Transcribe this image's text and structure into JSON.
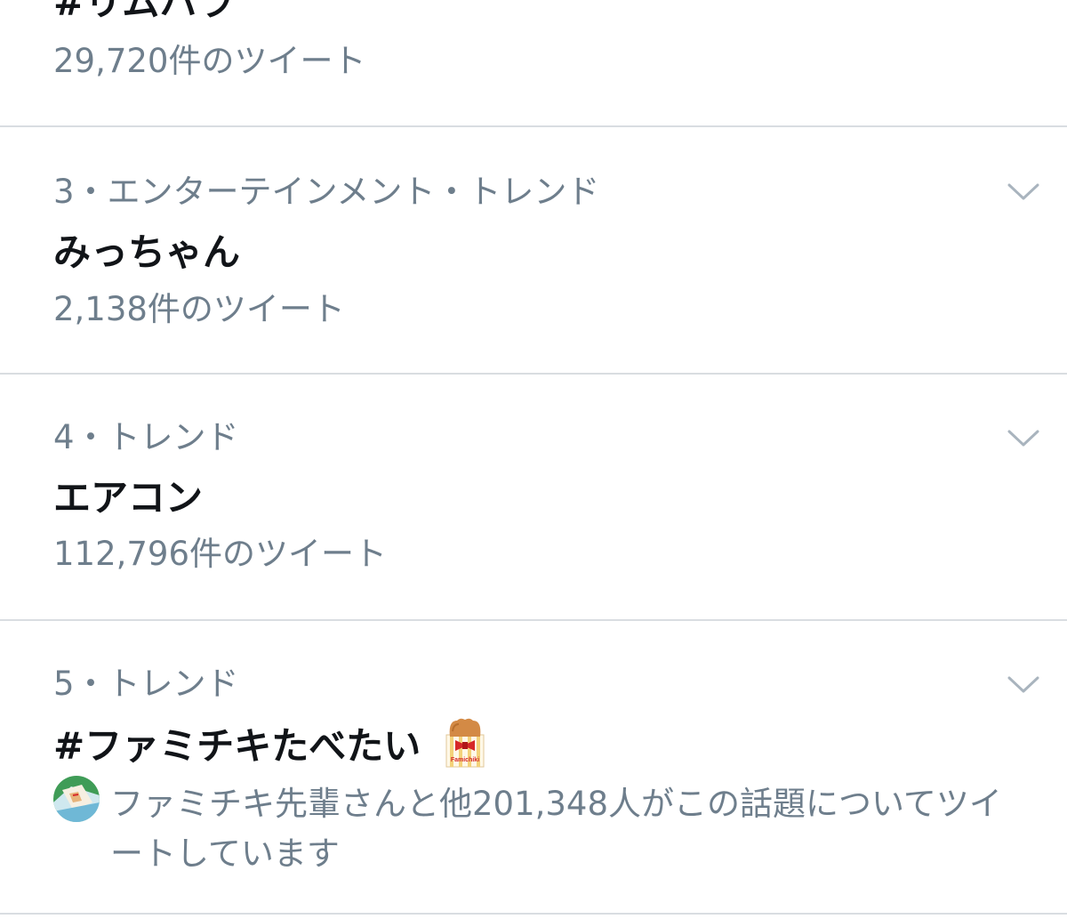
{
  "trends": [
    {
      "name": "#リムハラ",
      "tweet_count": "29,720件のツイート"
    },
    {
      "meta": "3・エンターテインメント・トレンド",
      "name": "みっちゃん",
      "tweet_count": "2,138件のツイート"
    },
    {
      "meta": "4・トレンド",
      "name": "エアコン",
      "tweet_count": "112,796件のツイート"
    },
    {
      "meta": "5・トレンド",
      "name": "#ファミチキたべたい",
      "icon_label": "Famichiki",
      "context": "ファミチキ先輩さんと他201,348人がこの話題についてツイートしています"
    }
  ],
  "icons": {
    "more": "chevron-down-icon",
    "promo": "famichiki-icon",
    "user": "avatar"
  },
  "colors": {
    "primary_text": "#111418",
    "secondary_text": "#6e7e8c",
    "divider": "#d9dde1",
    "background": "#ffffff"
  }
}
